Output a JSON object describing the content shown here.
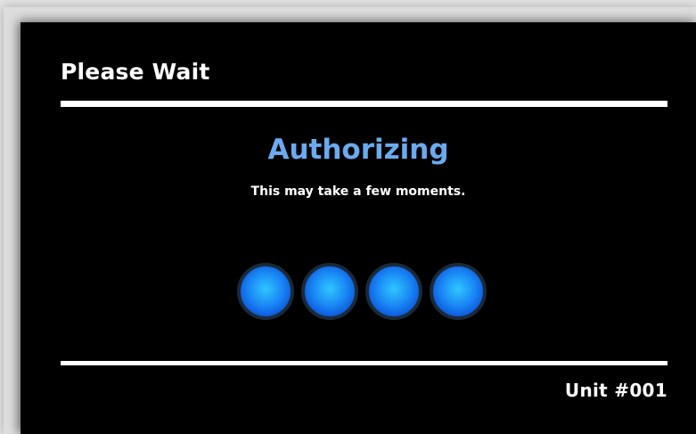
{
  "header": {
    "title": "Please Wait"
  },
  "status": {
    "heading": "Authorizing",
    "message": "This may take a few moments.",
    "heading_color": "#6aaaf0"
  },
  "progress": {
    "indicator_count": 4,
    "indicator_color": "#1a88f5"
  },
  "footer": {
    "unit": "Unit #001"
  },
  "colors": {
    "screen_background": "#000000",
    "text": "#ffffff",
    "rule": "#ffffff"
  }
}
